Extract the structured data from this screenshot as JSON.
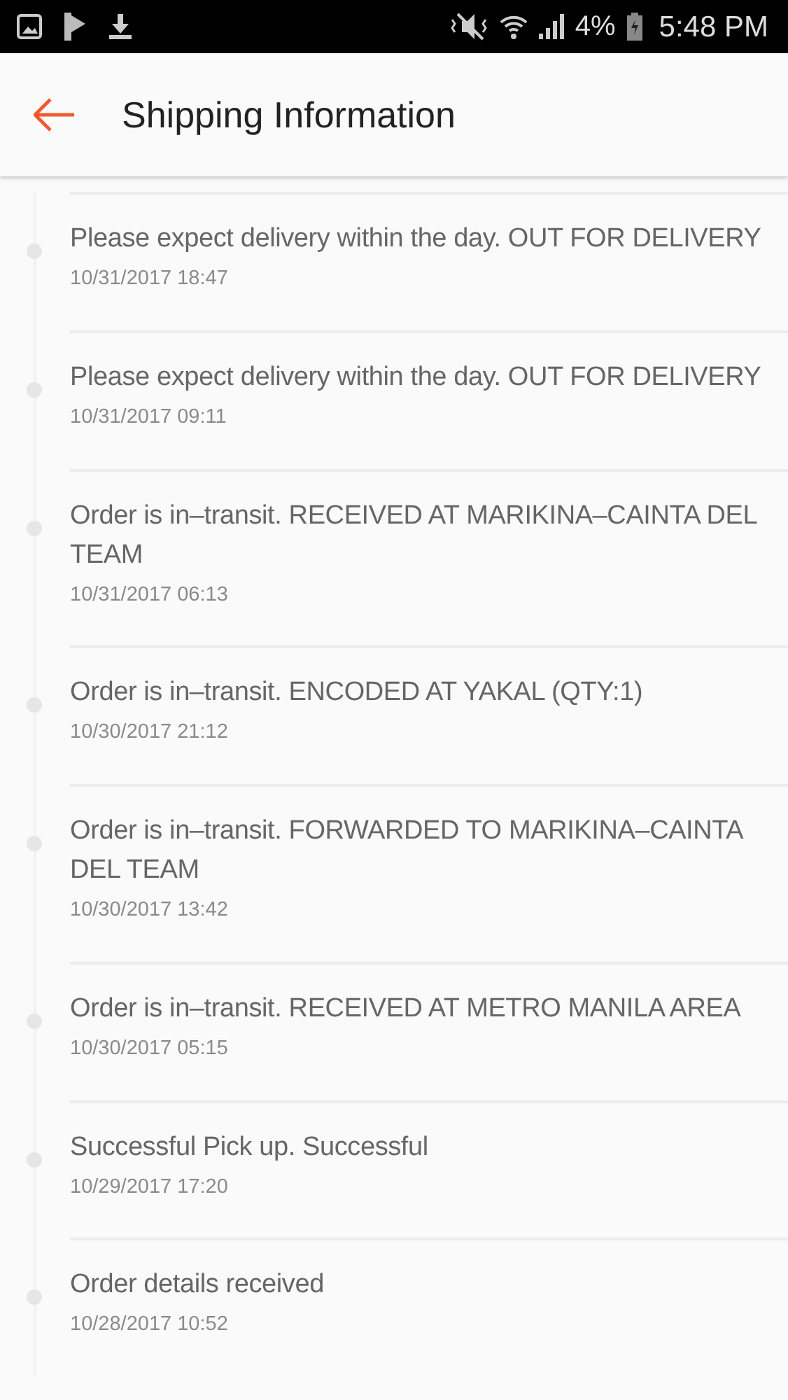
{
  "status_bar": {
    "battery": "4%",
    "time": "5:48 PM"
  },
  "header": {
    "title": "Shipping Information"
  },
  "events": [
    {
      "message": "Please expect delivery within the day. OUT FOR DELIVERY",
      "time": "10/31/2017 18:47"
    },
    {
      "message": "Please expect delivery within the day. OUT FOR DELIVERY",
      "time": "10/31/2017 09:11"
    },
    {
      "message": "Order is in–transit. RECEIVED AT MARIKINA–CAINTA DEL TEAM",
      "time": "10/31/2017 06:13"
    },
    {
      "message": "Order is in–transit. ENCODED AT YAKAL (QTY:1)",
      "time": "10/30/2017 21:12"
    },
    {
      "message": "Order is in–transit. FORWARDED TO MARIKINA–CAINTA DEL TEAM",
      "time": "10/30/2017 13:42"
    },
    {
      "message": "Order is in–transit. RECEIVED AT METRO MANILA AREA",
      "time": "10/30/2017 05:15"
    },
    {
      "message": "Successful Pick up. Successful",
      "time": "10/29/2017 17:20"
    },
    {
      "message": "Order details received",
      "time": "10/28/2017 10:52"
    }
  ]
}
